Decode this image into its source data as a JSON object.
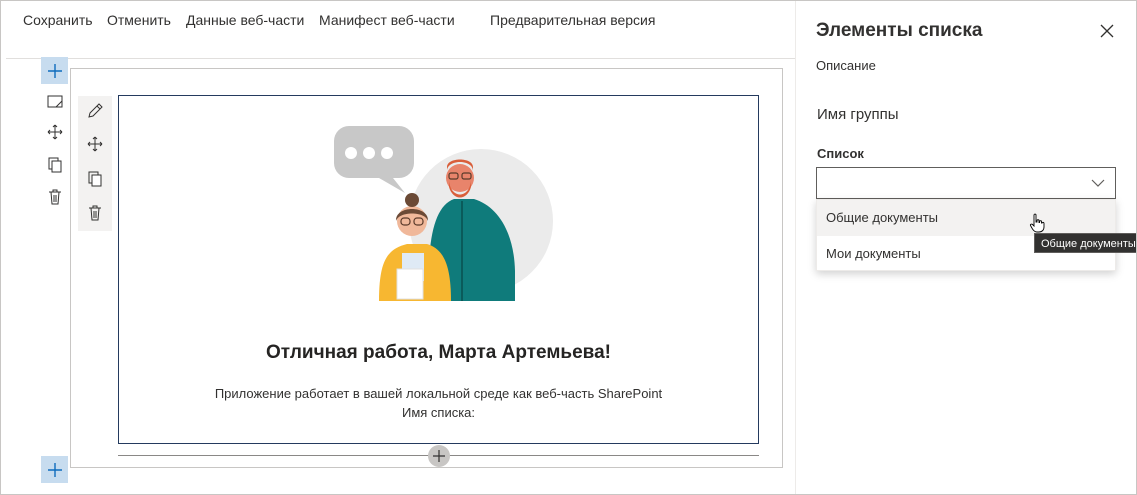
{
  "toolbar": {
    "save": "Сохранить",
    "cancel": "Отменить",
    "webpart_data": "Данные веб-части",
    "webpart_manifest": "Манифест веб-части",
    "preview": "Предварительная версия"
  },
  "webpart": {
    "title": "Отличная работа, Марта Артемьева!",
    "description": "Приложение работает в вашей локальной среде как веб-часть SharePoint",
    "list_name_label": "Имя списка:"
  },
  "property_pane": {
    "title": "Элементы списка",
    "description": "Описание",
    "group_name": "Имя группы",
    "list_label": "Список",
    "dropdown_value": "",
    "options": [
      "Общие документы",
      "Мои документы"
    ],
    "hovered_option": "Общие документы",
    "tooltip": "Общие документы"
  },
  "colors": {
    "accent": "#0f6cbd",
    "add_button_bg": "#c7dcef",
    "webpart_border": "#243a5e",
    "hover_bg": "#f3f2f1",
    "tooltip_bg": "#323130"
  },
  "icons": [
    "plus-icon",
    "edit-icon",
    "move-icon",
    "copy-icon",
    "delete-icon",
    "close-icon",
    "chevron-down-icon",
    "hand-cursor-icon"
  ]
}
